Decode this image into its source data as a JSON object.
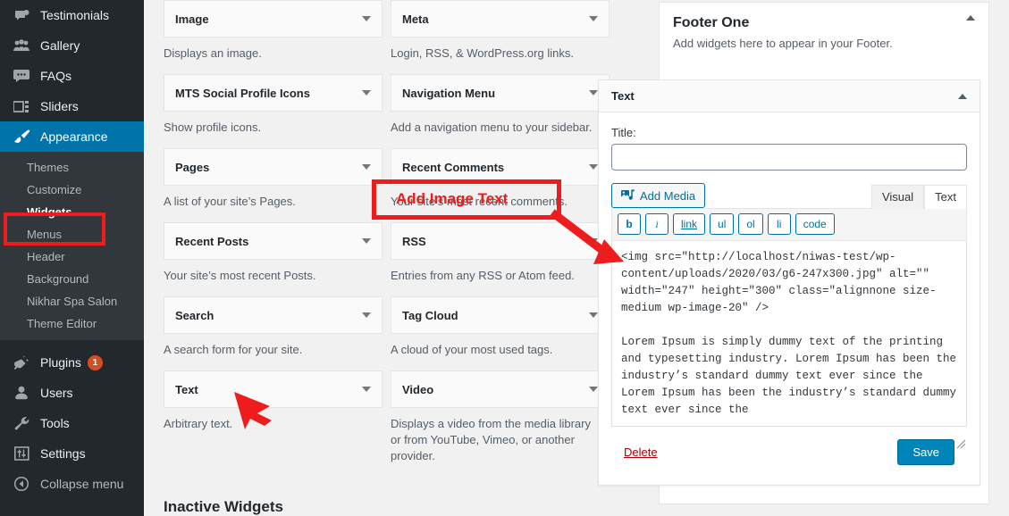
{
  "sidebar": {
    "top_items": [
      {
        "label": "Testimonials",
        "icon": "testimonials-icon"
      },
      {
        "label": "Gallery",
        "icon": "gallery-icon"
      },
      {
        "label": "FAQs",
        "icon": "faq-icon"
      },
      {
        "label": "Sliders",
        "icon": "sliders-icon"
      }
    ],
    "current": {
      "label": "Appearance",
      "icon": "appearance-brush-icon"
    },
    "submenu": [
      {
        "label": "Themes",
        "active": false
      },
      {
        "label": "Customize",
        "active": false
      },
      {
        "label": "Widgets",
        "active": true
      },
      {
        "label": "Menus",
        "active": false
      },
      {
        "label": "Header",
        "active": false
      },
      {
        "label": "Background",
        "active": false
      },
      {
        "label": "Nikhar Spa Salon",
        "active": false
      },
      {
        "label": "Theme Editor",
        "active": false
      }
    ],
    "bottom_items": [
      {
        "label": "Plugins",
        "icon": "plugins-icon",
        "badge": "1"
      },
      {
        "label": "Users",
        "icon": "users-icon",
        "badge": ""
      },
      {
        "label": "Tools",
        "icon": "tools-wrench-icon",
        "badge": ""
      },
      {
        "label": "Settings",
        "icon": "settings-sliders-icon",
        "badge": ""
      }
    ],
    "collapse": {
      "label": "Collapse menu",
      "icon": "collapse-arrow-icon"
    }
  },
  "available_widgets": {
    "left_column": [
      {
        "title": "Image",
        "description": "Displays an image."
      },
      {
        "title": "MTS Social Profile Icons",
        "description": "Show profile icons."
      },
      {
        "title": "Pages",
        "description": "A list of your site’s Pages."
      },
      {
        "title": "Recent Posts",
        "description": "Your site’s most recent Posts."
      },
      {
        "title": "Search",
        "description": "A search form for your site."
      },
      {
        "title": "Text",
        "description": "Arbitrary text."
      }
    ],
    "right_column": [
      {
        "title": "Meta",
        "description": "Login, RSS, & WordPress.org links."
      },
      {
        "title": "Navigation Menu",
        "description": "Add a navigation menu to your sidebar."
      },
      {
        "title": "Recent Comments",
        "description": "Your site’s most recent comments."
      },
      {
        "title": "RSS",
        "description": "Entries from any RSS or Atom feed."
      },
      {
        "title": "Tag Cloud",
        "description": "A cloud of your most used tags."
      },
      {
        "title": "Video",
        "description": "Displays a video from the media library or from YouTube, Vimeo, or another provider."
      }
    ],
    "inactive_heading": "Inactive Widgets"
  },
  "footer_panel": {
    "title": "Footer One",
    "description": "Add widgets here to appear in your Footer."
  },
  "text_widget": {
    "header": "Text",
    "title_label": "Title:",
    "title_value": "",
    "title_placeholder": "",
    "add_media_label": "Add Media",
    "tabs": [
      {
        "label": "Visual",
        "active": false
      },
      {
        "label": "Text",
        "active": true
      }
    ],
    "quicktags": [
      "b",
      "i",
      "link",
      "ul",
      "ol",
      "li",
      "code"
    ],
    "content": "<img src=\"http://localhost/niwas-test/wp-content/uploads/2020/03/g6-247x300.jpg\" alt=\"\" width=\"247\" height=\"300\" class=\"alignnone size-medium wp-image-20\" />\n\nLorem Ipsum is simply dummy text of the printing and typesetting industry. Lorem Ipsum has been the industry’s standard dummy text ever since the Lorem Ipsum has been the industry’s standard dummy text ever since the",
    "delete_label": "Delete",
    "save_label": "Save"
  },
  "annotations": {
    "add_image_text": "Add Image Text",
    "highlight_color": "#ee1c1c"
  }
}
